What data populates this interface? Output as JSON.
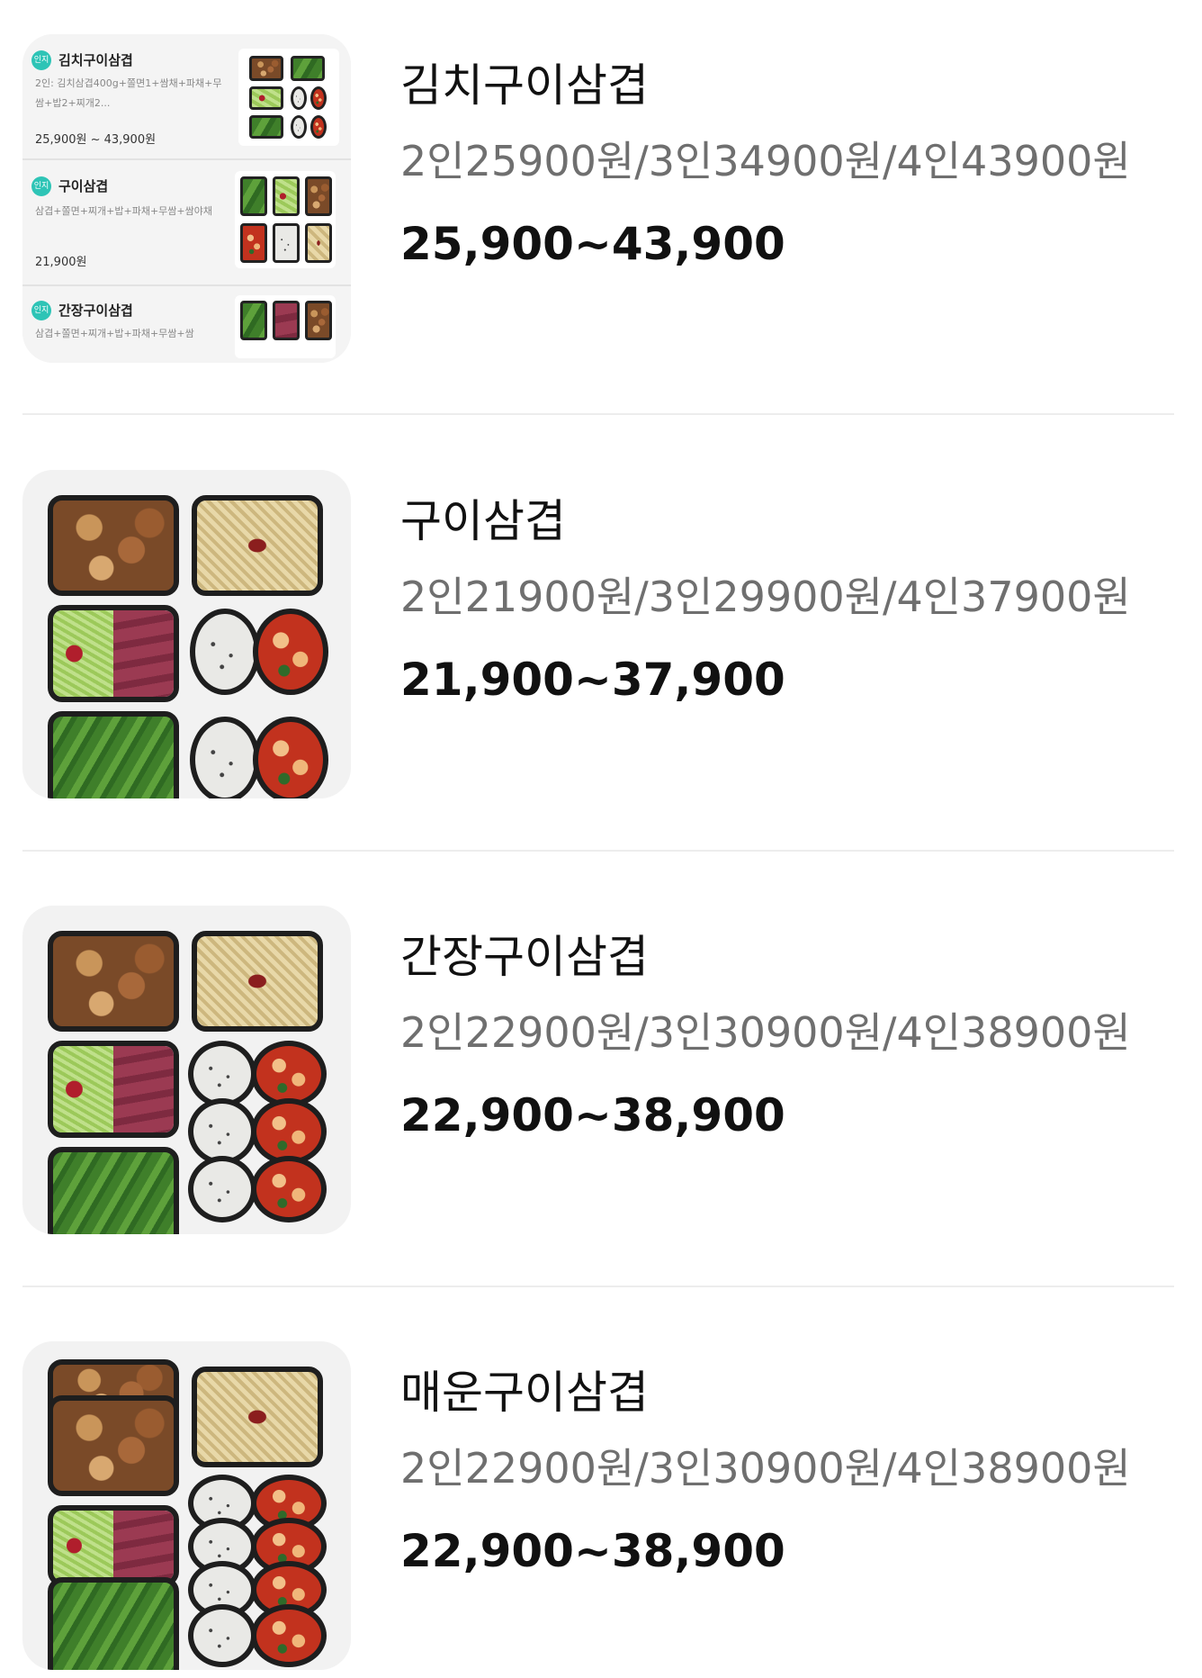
{
  "products": [
    {
      "name": "김치구이삼겹",
      "detail": "2인25900원/3인34900원/4인43900원",
      "price": "25,900~43,900",
      "screenshot_rows": [
        {
          "badge": "인지",
          "title": "김치구이삼겹",
          "desc": "2인: 김치삼겹400g+쫄면1+쌈채+파채+무쌈+밥2+찌개2...",
          "price": "25,900원 ~ 43,900원"
        },
        {
          "badge": "인지",
          "title": "구이삼겹",
          "desc": "삼겹+쫄면+찌개+밥+파채+무쌈+쌈야채",
          "price": "21,900원"
        },
        {
          "badge": "인지",
          "title": "간장구이삼겹",
          "desc": "삼겹+쫄면+찌개+밥+파채+무쌈+쌈",
          "price": ""
        }
      ]
    },
    {
      "name": "구이삼겹",
      "detail": "2인21900원/3인29900원/4인37900원",
      "price": "21,900~37,900"
    },
    {
      "name": "간장구이삼겹",
      "detail": "2인22900원/3인30900원/4인38900원",
      "price": "22,900~38,900"
    },
    {
      "name": "매운구이삼겹",
      "detail": "2인22900원/3인30900원/4인38900원",
      "price": "22,900~38,900"
    }
  ]
}
